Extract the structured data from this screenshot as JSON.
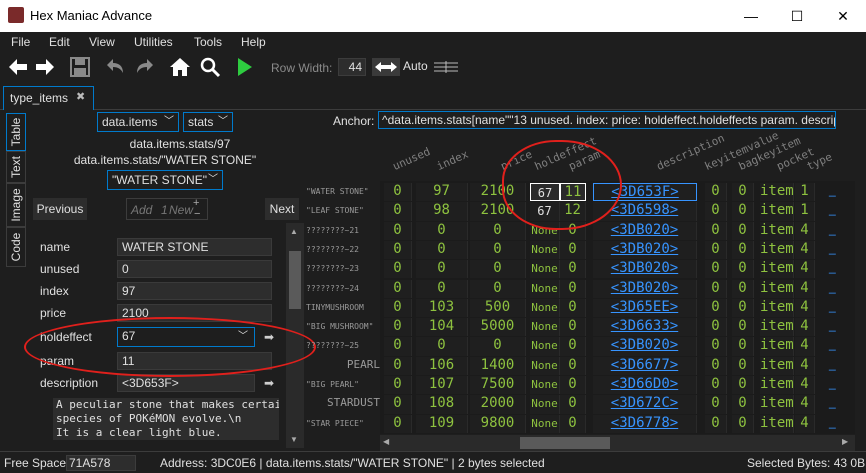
{
  "window": {
    "title": "Hex Maniac Advance",
    "min": "—",
    "max": "☐",
    "close": "✕"
  },
  "menu": [
    "File",
    "Edit",
    "View",
    "Utilities",
    "Tools",
    "Help"
  ],
  "toolbar": {
    "row_width_label": "Row Width:",
    "row_width_value": "44",
    "auto_label": "Auto"
  },
  "tab": {
    "label": "type_items",
    "close": "✖"
  },
  "side_tabs": [
    "Table",
    "Text",
    "Image",
    "Code"
  ],
  "table_panel": {
    "dropdown1": "data.items",
    "dropdown2": "stats",
    "path1": "data.items.stats/97",
    "path2": "data.items.stats/\"WATER STONE\"",
    "selector": "\"WATER STONE\"",
    "previous": "Previous",
    "add_label": "Add",
    "add_count": "1",
    "new_label": "New",
    "next": "Next",
    "fields": [
      {
        "label": "name",
        "value": "WATER STONE"
      },
      {
        "label": "unused",
        "value": "0"
      },
      {
        "label": "index",
        "value": "97"
      },
      {
        "label": "price",
        "value": "2100"
      },
      {
        "label": "holdeffect",
        "value": "67"
      },
      {
        "label": "param",
        "value": "11"
      },
      {
        "label": "description",
        "value": "<3D653F>"
      }
    ],
    "description_text": "A peculiar stone that makes certai\nspecies of POKéMON evolve.\\n\nIt is a clear light blue."
  },
  "anchor": {
    "label": "Anchor:",
    "value": "^data.items.stats[name\"\"13 unused. index: price: holdeffect.holdeffects param. description<\"\"> keyitemvalue. bagkeyitem. pocket. type."
  },
  "columns": [
    "unused",
    "index",
    "price",
    "holdeffect",
    "param",
    "description",
    "keyitemvalue",
    "bagkeyitem",
    "pocket",
    "type"
  ],
  "rows": [
    {
      "name": "\"WATER STONE\"",
      "big": false,
      "unused": "0",
      "index": "97",
      "price": "2100",
      "holdeffect": "67",
      "param": "11",
      "description": "<3D653F>",
      "keyitemvalue": "0",
      "bagkeyitem": "0",
      "pocket": "item",
      "type": "1"
    },
    {
      "name": "\"LEAF STONE\"",
      "big": false,
      "unused": "0",
      "index": "98",
      "price": "2100",
      "holdeffect": "67",
      "param": "12",
      "description": "<3D6598>",
      "keyitemvalue": "0",
      "bagkeyitem": "0",
      "pocket": "item",
      "type": "1"
    },
    {
      "name": "????????~21",
      "big": false,
      "unused": "0",
      "index": "0",
      "price": "0",
      "holdeffect": "None",
      "param": "0",
      "description": "<3DB020>",
      "keyitemvalue": "0",
      "bagkeyitem": "0",
      "pocket": "item",
      "type": "4"
    },
    {
      "name": "????????~22",
      "big": false,
      "unused": "0",
      "index": "0",
      "price": "0",
      "holdeffect": "None",
      "param": "0",
      "description": "<3DB020>",
      "keyitemvalue": "0",
      "bagkeyitem": "0",
      "pocket": "item",
      "type": "4"
    },
    {
      "name": "????????~23",
      "big": false,
      "unused": "0",
      "index": "0",
      "price": "0",
      "holdeffect": "None",
      "param": "0",
      "description": "<3DB020>",
      "keyitemvalue": "0",
      "bagkeyitem": "0",
      "pocket": "item",
      "type": "4"
    },
    {
      "name": "????????~24",
      "big": false,
      "unused": "0",
      "index": "0",
      "price": "0",
      "holdeffect": "None",
      "param": "0",
      "description": "<3DB020>",
      "keyitemvalue": "0",
      "bagkeyitem": "0",
      "pocket": "item",
      "type": "4"
    },
    {
      "name": "TINYMUSHROOM",
      "big": false,
      "unused": "0",
      "index": "103",
      "price": "500",
      "holdeffect": "None",
      "param": "0",
      "description": "<3D65EE>",
      "keyitemvalue": "0",
      "bagkeyitem": "0",
      "pocket": "item",
      "type": "4"
    },
    {
      "name": "\"BIG MUSHROOM\"",
      "big": false,
      "unused": "0",
      "index": "104",
      "price": "5000",
      "holdeffect": "None",
      "param": "0",
      "description": "<3D6633>",
      "keyitemvalue": "0",
      "bagkeyitem": "0",
      "pocket": "item",
      "type": "4"
    },
    {
      "name": "????????~25",
      "big": false,
      "unused": "0",
      "index": "0",
      "price": "0",
      "holdeffect": "None",
      "param": "0",
      "description": "<3DB020>",
      "keyitemvalue": "0",
      "bagkeyitem": "0",
      "pocket": "item",
      "type": "4"
    },
    {
      "name": "PEARL",
      "big": true,
      "unused": "0",
      "index": "106",
      "price": "1400",
      "holdeffect": "None",
      "param": "0",
      "description": "<3D6677>",
      "keyitemvalue": "0",
      "bagkeyitem": "0",
      "pocket": "item",
      "type": "4"
    },
    {
      "name": "\"BIG PEARL\"",
      "big": false,
      "unused": "0",
      "index": "107",
      "price": "7500",
      "holdeffect": "None",
      "param": "0",
      "description": "<3D66D0>",
      "keyitemvalue": "0",
      "bagkeyitem": "0",
      "pocket": "item",
      "type": "4"
    },
    {
      "name": "STARDUST",
      "big": true,
      "unused": "0",
      "index": "108",
      "price": "2000",
      "holdeffect": "None",
      "param": "0",
      "description": "<3D672C>",
      "keyitemvalue": "0",
      "bagkeyitem": "0",
      "pocket": "item",
      "type": "4"
    },
    {
      "name": "\"STAR PIECE\"",
      "big": false,
      "unused": "0",
      "index": "109",
      "price": "9800",
      "holdeffect": "None",
      "param": "0",
      "description": "<3D6778>",
      "keyitemvalue": "0",
      "bagkeyitem": "0",
      "pocket": "item",
      "type": "4"
    }
  ],
  "status": {
    "free_space_label": "Free Space:",
    "free_space_value": "71A578",
    "address": "Address: 3DC0E6 | data.items.stats/\"WATER STONE\" | 2 bytes selected",
    "selected": "Selected Bytes: 43 0B"
  },
  "colors": {
    "accent": "#007acc",
    "number": "#8ec23f",
    "link": "#3794ff",
    "annotation": "#e0201c",
    "background": "#1e1e1e"
  }
}
